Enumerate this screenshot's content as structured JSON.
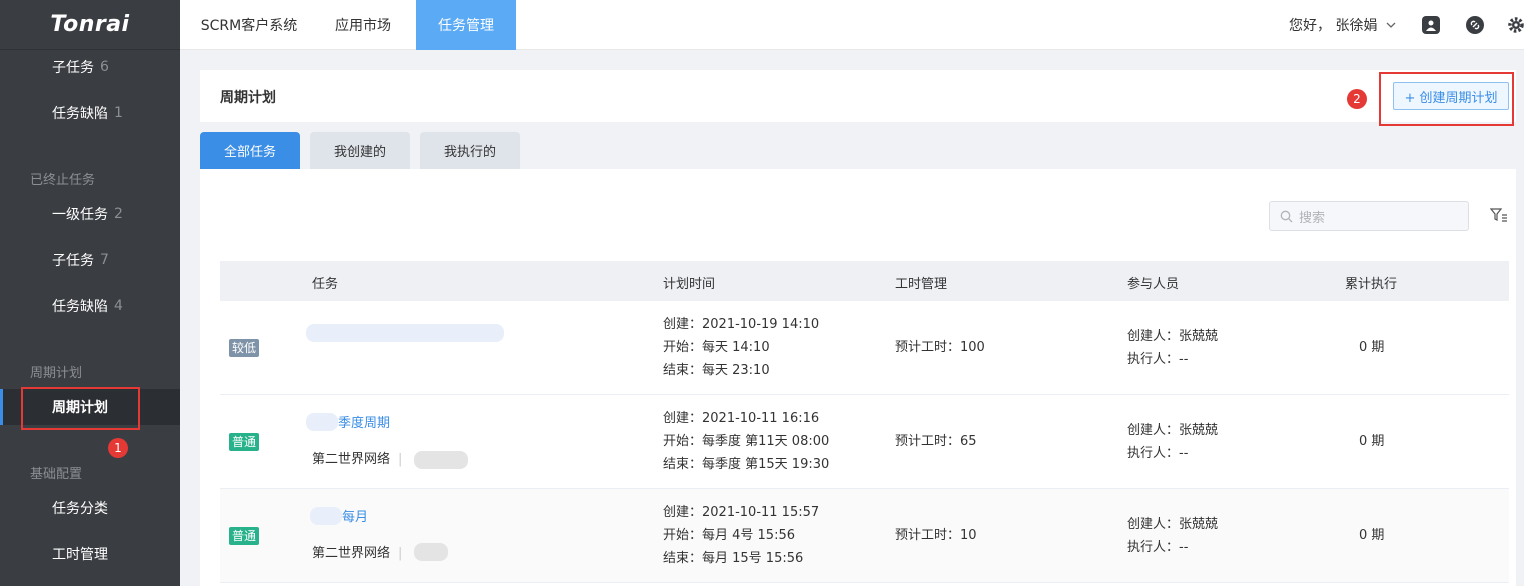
{
  "app": {
    "logo": "Tonrai"
  },
  "topnav": {
    "tabs": [
      {
        "label": "SCRM客户系统"
      },
      {
        "label": "应用市场"
      },
      {
        "label": "任务管理"
      }
    ],
    "greeting": "您好，  张徐娟",
    "icons": [
      "user-badge-icon",
      "link-icon",
      "gear-icon"
    ]
  },
  "sidebar": {
    "items_top": [
      {
        "label": "子任务",
        "count": "6"
      },
      {
        "label": "任务缺陷",
        "count": "1"
      }
    ],
    "group_terminated": "已终止任务",
    "items_terminated": [
      {
        "label": "一级任务",
        "count": "2"
      },
      {
        "label": "子任务",
        "count": "7"
      },
      {
        "label": "任务缺陷",
        "count": "4"
      }
    ],
    "group_periodic": "周期计划",
    "item_periodic": {
      "label": "周期计划"
    },
    "group_config": "基础配置",
    "items_config": [
      {
        "label": "任务分类"
      },
      {
        "label": "工时管理"
      }
    ]
  },
  "annotations": {
    "marker1": "1",
    "marker2": "2"
  },
  "header": {
    "title": "周期计划",
    "create_label": "+ 创建周期计划"
  },
  "tabs": [
    {
      "label": "全部任务"
    },
    {
      "label": "我创建的"
    },
    {
      "label": "我执行的"
    }
  ],
  "search": {
    "placeholder": "搜索"
  },
  "table": {
    "columns": [
      "任务",
      "计划时间",
      "工时管理",
      "参与人员",
      "累计执行"
    ],
    "rows": [
      {
        "priority": "较低",
        "name": "",
        "org": "",
        "created": "创建：2021-10-19 14:10",
        "start": "开始：每天 14:10",
        "end": "结束：每天 23:10",
        "hours": "预计工时：100",
        "creator": "创建人：张兢兢",
        "executor": "执行人：--",
        "runs": "0 期"
      },
      {
        "priority": "普通",
        "name": "季度周期",
        "org": "第二世界网络",
        "created": "创建：2021-10-11 16:16",
        "start": "开始：每季度 第11天 08:00",
        "end": "结束：每季度 第15天 19:30",
        "hours": "预计工时：65",
        "creator": "创建人：张兢兢",
        "executor": "执行人：--",
        "runs": "0 期"
      },
      {
        "priority": "普通",
        "name": "每月",
        "org": "第二世界网络",
        "created": "创建：2021-10-11 15:57",
        "start": "开始：每月 4号 15:56",
        "end": "结束：每月 15号 15:56",
        "hours": "预计工时：10",
        "creator": "创建人：张兢兢",
        "executor": "执行人：--",
        "runs": "0 期"
      }
    ]
  },
  "colors": {
    "accent": "#3a8ee6",
    "sidebar": "#3a3d42",
    "annotation": "#e53935"
  }
}
